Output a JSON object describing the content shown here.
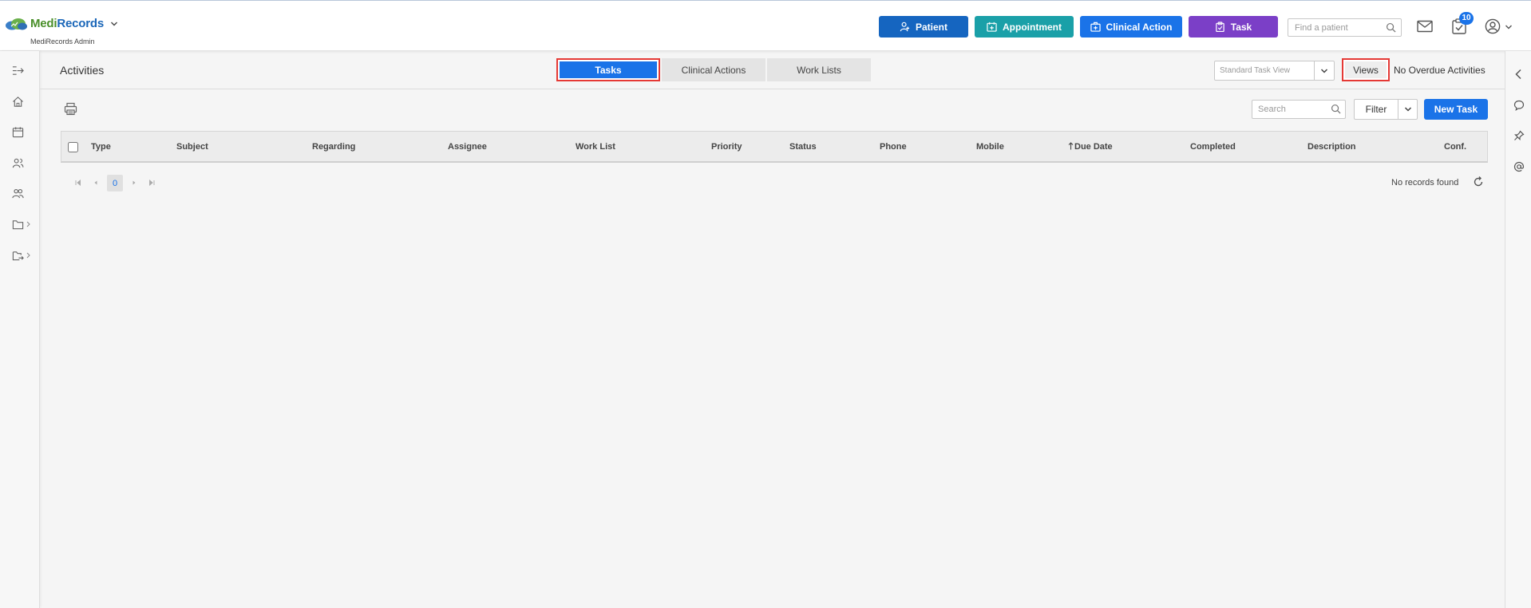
{
  "app": {
    "brand_part1": "Medi",
    "brand_part2": "Records",
    "subtitle": "MediRecords Admin",
    "brand_colors": {
      "medi": "#4a8f2a",
      "records": "#1a66b8"
    }
  },
  "header": {
    "actions": [
      {
        "label": "Patient",
        "icon": "add-user-icon",
        "color": "#1565c0"
      },
      {
        "label": "Appointment",
        "icon": "calendar-plus-icon",
        "color": "#1aa0a8"
      },
      {
        "label": "Clinical Action",
        "icon": "medical-bag-icon",
        "color": "#1a73e8"
      },
      {
        "label": "Task",
        "icon": "clipboard-icon",
        "color": "#7b3fc7"
      }
    ],
    "find_patient_placeholder": "Find a patient",
    "task_badge_count": "10"
  },
  "sidebar": {
    "items": [
      {
        "icon": "expand-sidebar-icon"
      },
      {
        "icon": "home-icon"
      },
      {
        "icon": "calendar-icon"
      },
      {
        "icon": "patients-icon"
      },
      {
        "icon": "users-icon"
      },
      {
        "icon": "folder-icon",
        "submenu": true
      },
      {
        "icon": "folder-export-icon",
        "submenu": true
      }
    ]
  },
  "rightbar": {
    "items": [
      {
        "icon": "collapse-left-icon"
      },
      {
        "icon": "chat-icon"
      },
      {
        "icon": "pin-icon"
      },
      {
        "icon": "at-sign-icon"
      }
    ]
  },
  "page": {
    "title": "Activities",
    "tabs": [
      {
        "label": "Tasks",
        "active": true
      },
      {
        "label": "Clinical Actions",
        "active": false
      },
      {
        "label": "Work Lists",
        "active": false
      }
    ],
    "view_selected": "Standard Task View",
    "views_label": "Views",
    "overdue_text": "No Overdue Activities"
  },
  "grid": {
    "search_placeholder": "Search",
    "filter_label": "Filter",
    "new_task_label": "New Task",
    "columns": [
      "Type",
      "Subject",
      "Regarding",
      "Assignee",
      "Work List",
      "Priority",
      "Status",
      "Phone",
      "Mobile",
      "Due Date",
      "Completed",
      "Description",
      "Conf."
    ],
    "sorted_column": "Due Date",
    "current_page": "0",
    "no_records": "No records found"
  }
}
